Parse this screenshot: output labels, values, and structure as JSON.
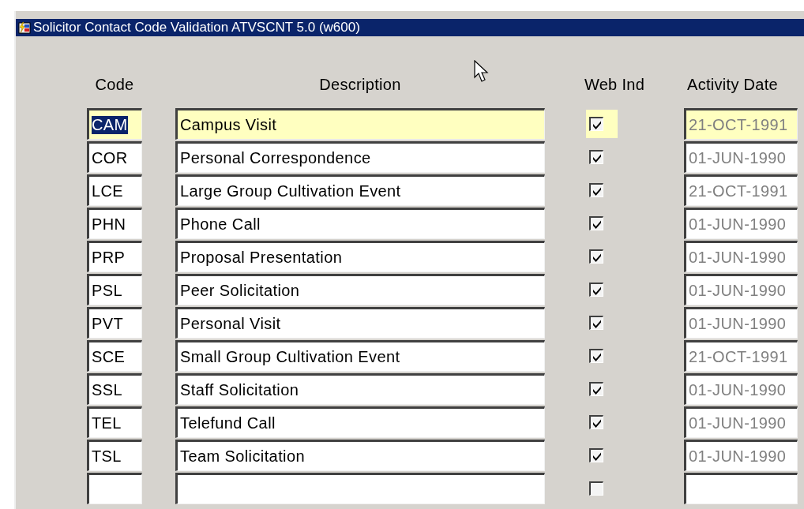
{
  "window": {
    "title": "Solicitor Contact Code Validation  ATVSCNT  5.0  (w600)"
  },
  "columns": [
    "Code",
    "Description",
    "Web Ind",
    "Activity Date"
  ],
  "rows": [
    {
      "code": "CAM",
      "description": "Campus Visit",
      "web_ind": true,
      "activity_date": "21-OCT-1991",
      "current": true,
      "selected": true
    },
    {
      "code": "COR",
      "description": "Personal Correspondence",
      "web_ind": true,
      "activity_date": "01-JUN-1990",
      "current": false,
      "selected": false
    },
    {
      "code": "LCE",
      "description": "Large Group Cultivation Event",
      "web_ind": true,
      "activity_date": "21-OCT-1991",
      "current": false,
      "selected": false
    },
    {
      "code": "PHN",
      "description": "Phone Call",
      "web_ind": true,
      "activity_date": "01-JUN-1990",
      "current": false,
      "selected": false
    },
    {
      "code": "PRP",
      "description": "Proposal Presentation",
      "web_ind": true,
      "activity_date": "01-JUN-1990",
      "current": false,
      "selected": false
    },
    {
      "code": "PSL",
      "description": "Peer Solicitation",
      "web_ind": true,
      "activity_date": "01-JUN-1990",
      "current": false,
      "selected": false
    },
    {
      "code": "PVT",
      "description": "Personal Visit",
      "web_ind": true,
      "activity_date": "01-JUN-1990",
      "current": false,
      "selected": false
    },
    {
      "code": "SCE",
      "description": "Small Group Cultivation Event",
      "web_ind": true,
      "activity_date": "21-OCT-1991",
      "current": false,
      "selected": false
    },
    {
      "code": "SSL",
      "description": "Staff Solicitation",
      "web_ind": true,
      "activity_date": "01-JUN-1990",
      "current": false,
      "selected": false
    },
    {
      "code": "TEL",
      "description": "Telefund Call",
      "web_ind": true,
      "activity_date": "01-JUN-1990",
      "current": false,
      "selected": false
    },
    {
      "code": "TSL",
      "description": "Team Solicitation",
      "web_ind": true,
      "activity_date": "01-JUN-1990",
      "current": false,
      "selected": false
    },
    {
      "web_ind": false,
      "current": false
    }
  ]
}
